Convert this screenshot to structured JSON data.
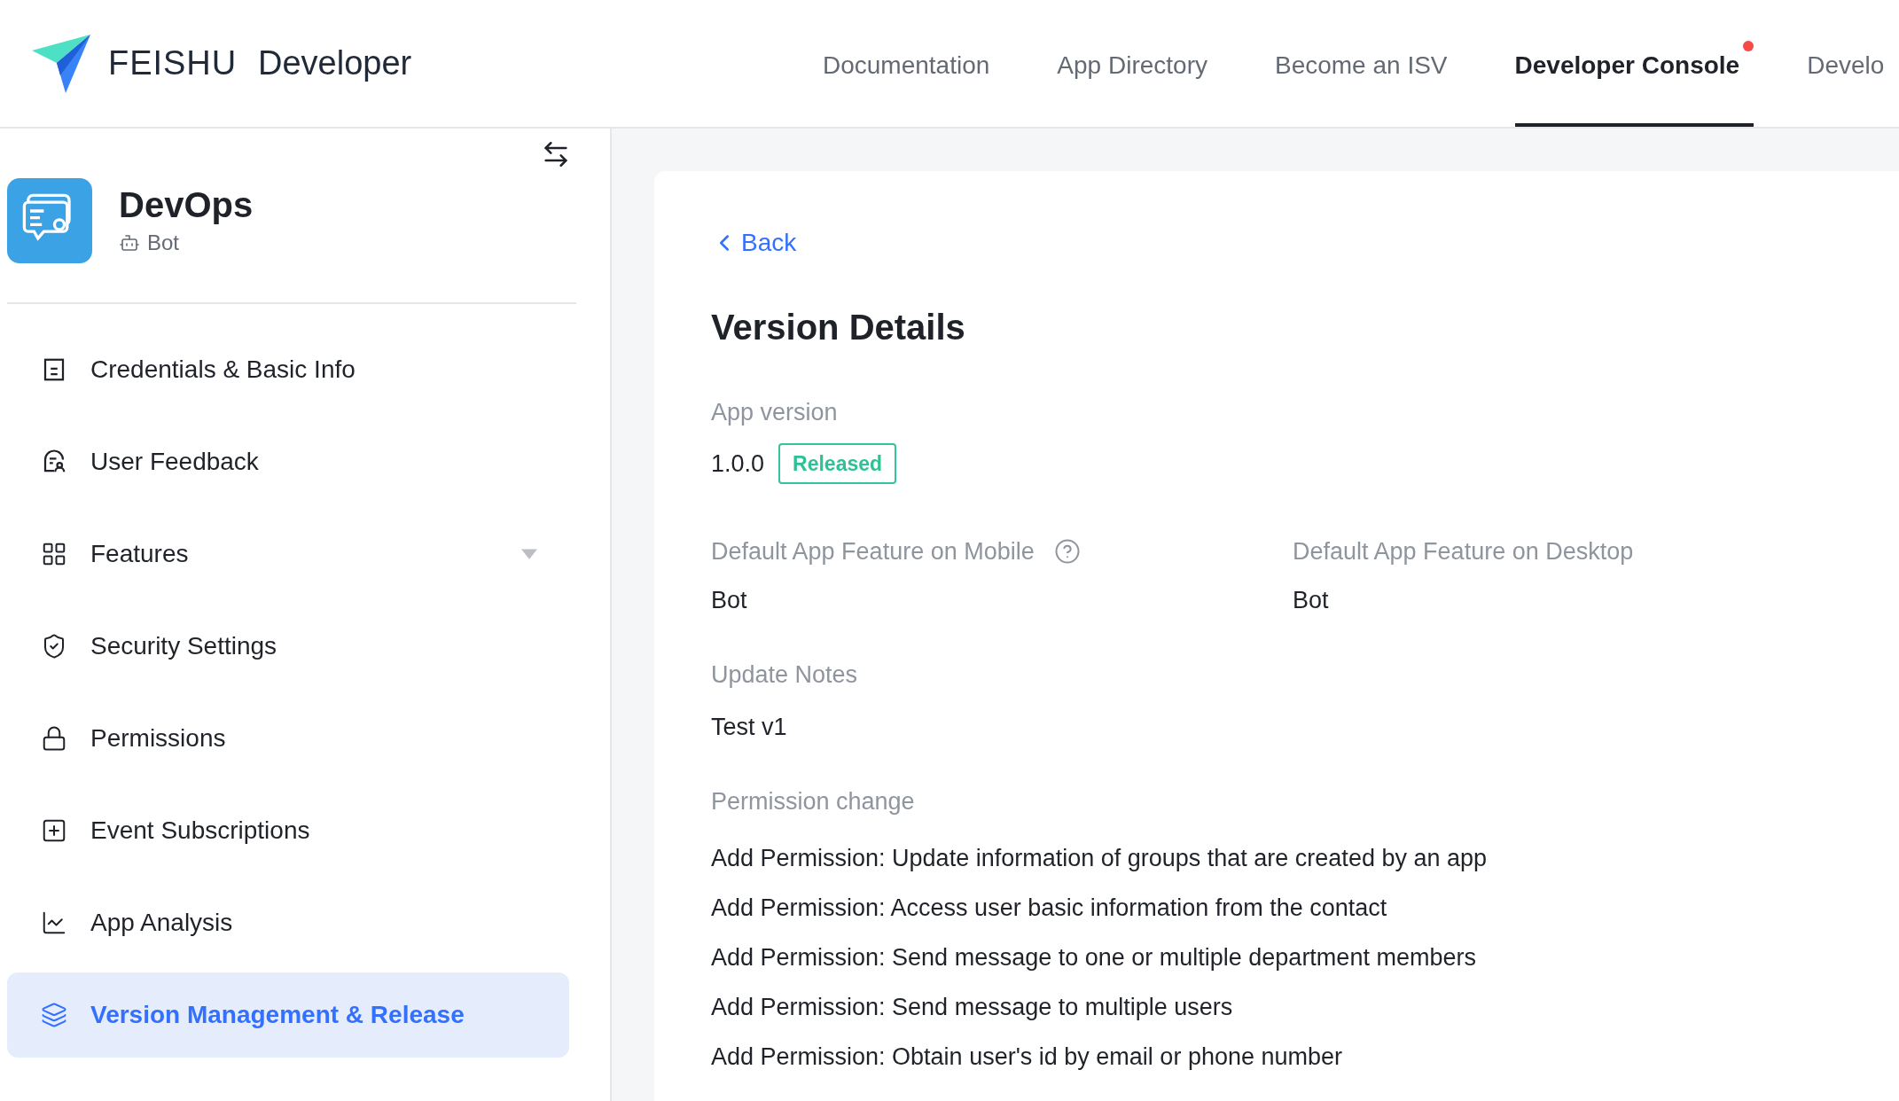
{
  "header": {
    "brand": "FEISHU",
    "product": "Developer",
    "nav": [
      {
        "label": "Documentation",
        "selected": false,
        "dot": false
      },
      {
        "label": "App Directory",
        "selected": false,
        "dot": false
      },
      {
        "label": "Become an ISV",
        "selected": false,
        "dot": false
      },
      {
        "label": "Developer Console",
        "selected": true,
        "dot": true
      },
      {
        "label": "Develo",
        "selected": false,
        "dot": false
      }
    ]
  },
  "sidebar": {
    "app": {
      "name": "DevOps",
      "type": "Bot"
    },
    "items": [
      {
        "label": "Credentials & Basic Info",
        "selected": false
      },
      {
        "label": "User Feedback",
        "selected": false
      },
      {
        "label": "Features",
        "selected": false,
        "expanded": false
      },
      {
        "label": "Security Settings",
        "selected": false
      },
      {
        "label": "Permissions",
        "selected": false
      },
      {
        "label": "Event Subscriptions",
        "selected": false
      },
      {
        "label": "App Analysis",
        "selected": false
      },
      {
        "label": "Version Management & Release",
        "selected": true
      }
    ]
  },
  "main": {
    "back": "Back",
    "title": "Version Details",
    "app_version": {
      "label": "App version",
      "value": "1.0.0",
      "status": "Released"
    },
    "features": [
      {
        "label": "Default App Feature on Mobile",
        "value": "Bot",
        "help": true
      },
      {
        "label": "Default App Feature on Desktop",
        "value": "Bot",
        "help": false
      }
    ],
    "update_notes": {
      "label": "Update Notes",
      "value": "Test v1"
    },
    "permission_change": {
      "label": "Permission change",
      "items": [
        "Add Permission: Update information of groups that are created by an app",
        "Add Permission: Access user basic information from the contact",
        "Add Permission: Send message to one or multiple department members",
        "Add Permission: Send message to multiple users",
        "Add Permission: Obtain user's id by email or phone number"
      ]
    }
  }
}
